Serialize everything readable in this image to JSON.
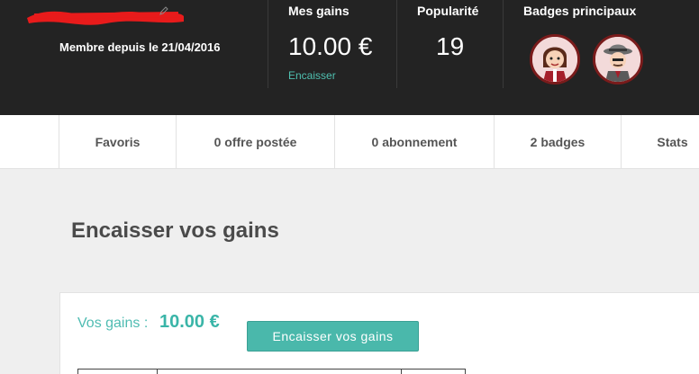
{
  "header": {
    "member_since": "Membre depuis le 21/04/2016",
    "gains_label": "Mes gains",
    "gains_value": "10.00 €",
    "cash_link": "Encaisser",
    "popularity_label": "Popularité",
    "popularity_value": "19",
    "badges_label": "Badges principaux",
    "badges": [
      {
        "icon": "girl-character-badge-icon"
      },
      {
        "icon": "detective-character-badge-icon"
      }
    ]
  },
  "tabs": [
    {
      "label": "Favoris"
    },
    {
      "label": "0 offre postée"
    },
    {
      "label": "0 abonnement"
    },
    {
      "label": "2 badges"
    },
    {
      "label": "Stats"
    }
  ],
  "main": {
    "title": "Encaisser vos gains",
    "gains_label": "Vos gains :",
    "gains_amount": "10.00 €",
    "cash_button": "Encaisser vos gains"
  },
  "colors": {
    "header_bg": "#232323",
    "accent": "#4ab8ab",
    "badge_border": "#7a1b1b"
  }
}
